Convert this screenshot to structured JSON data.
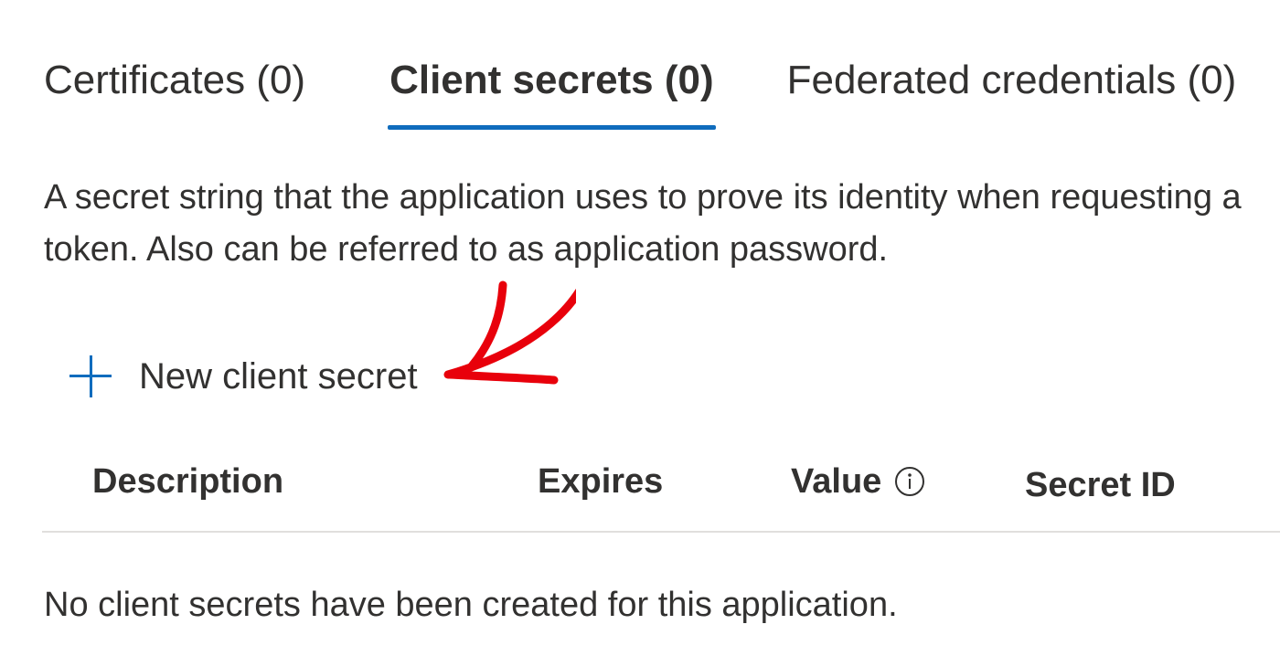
{
  "tabs": [
    {
      "label": "Certificates (0)",
      "active": false
    },
    {
      "label": "Client secrets (0)",
      "active": true
    },
    {
      "label": "Federated credentials (0)",
      "active": false
    }
  ],
  "description": "A secret string that the application uses to prove its identity when requesting a token. Also can be referred to as application password.",
  "toolbar": {
    "new_secret_label": "New client secret",
    "icon": "plus-icon"
  },
  "table": {
    "columns": [
      "Description",
      "Expires",
      "Value",
      "Secret ID"
    ],
    "value_info_icon": "info-icon",
    "empty_message": "No client secrets have been created for this application."
  },
  "colors": {
    "accent": "#0f6cbd",
    "annotation": "#e8000b",
    "text": "#323130",
    "divider": "#e1dfdd"
  }
}
